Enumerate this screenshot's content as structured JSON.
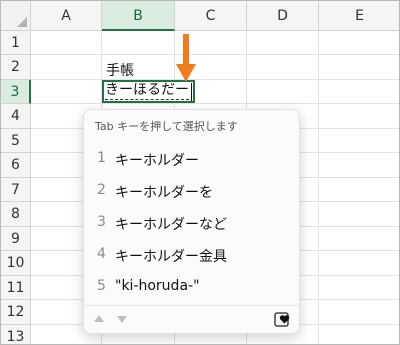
{
  "grid": {
    "columns": [
      "A",
      "B",
      "C",
      "D",
      "E"
    ],
    "rows": [
      "1",
      "2",
      "3",
      "4",
      "5",
      "6",
      "7",
      "8",
      "9",
      "10",
      "11",
      "12",
      "13"
    ],
    "selected_column": "B",
    "selected_row": "3"
  },
  "cells": {
    "b2": "手帳"
  },
  "ime": {
    "composition": "きーほるだー"
  },
  "candidates": {
    "hint": "Tab キーを押して選択します",
    "items": [
      {
        "num": "1",
        "text": "キーホルダー"
      },
      {
        "num": "2",
        "text": "キーホルダーを"
      },
      {
        "num": "3",
        "text": "キーホルダーなど"
      },
      {
        "num": "4",
        "text": "キーホルダー金具"
      },
      {
        "num": "5",
        "text": "\"ki-horuda-\""
      }
    ]
  },
  "colors": {
    "accent_green": "#217346",
    "arrow_orange": "#f07c1b"
  },
  "icons": {
    "nav_up": "triangle-up-icon",
    "nav_down": "triangle-down-icon",
    "favorite": "heart-box-icon"
  }
}
